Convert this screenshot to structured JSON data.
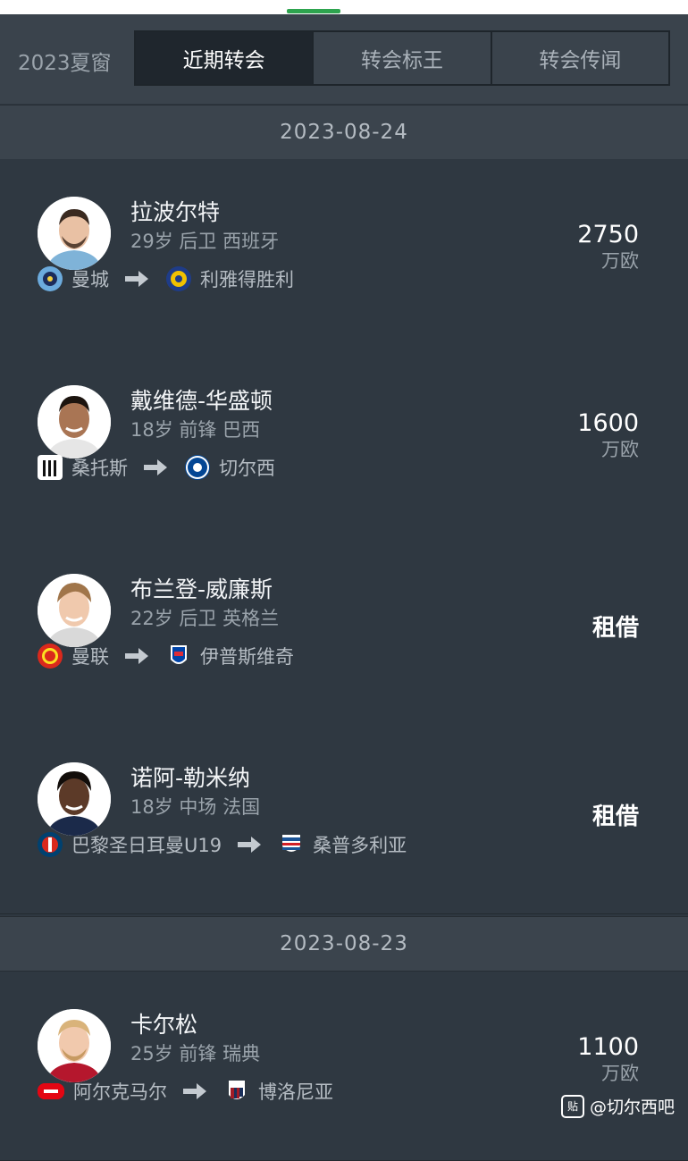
{
  "tabs": {
    "season_label": "2023夏窗",
    "items": [
      {
        "label": "近期转会",
        "active": true
      },
      {
        "label": "转会标王",
        "active": false
      },
      {
        "label": "转会传闻",
        "active": false
      }
    ]
  },
  "groups": [
    {
      "date": "2023-08-24",
      "transfers": [
        {
          "name": "拉波尔特",
          "info": "29岁 后卫 西班牙",
          "from": "曼城",
          "to": "利雅得胜利",
          "fee": "2750",
          "fee_unit": "万欧"
        },
        {
          "name": "戴维德-华盛顿",
          "info": "18岁 前锋 巴西",
          "from": "桑托斯",
          "to": "切尔西",
          "fee": "1600",
          "fee_unit": "万欧"
        },
        {
          "name": "布兰登-威廉斯",
          "info": "22岁 后卫 英格兰",
          "from": "曼联",
          "to": "伊普斯维奇",
          "loan": "租借"
        },
        {
          "name": "诺阿-勒米纳",
          "info": "18岁 中场 法国",
          "from": "巴黎圣日耳曼U19",
          "to": "桑普多利亚",
          "loan": "租借"
        }
      ]
    },
    {
      "date": "2023-08-23",
      "transfers": [
        {
          "name": "卡尔松",
          "info": "25岁 前锋 瑞典",
          "from": "阿尔克马尔",
          "to": "博洛尼亚",
          "fee": "1100",
          "fee_unit": "万欧"
        }
      ]
    }
  ],
  "watermark": {
    "icon_text": "贴",
    "text": "@切尔西吧"
  },
  "colors": {
    "background": "#2f3841",
    "tab_active": "#1f262d",
    "accent": "#2ea44f"
  }
}
